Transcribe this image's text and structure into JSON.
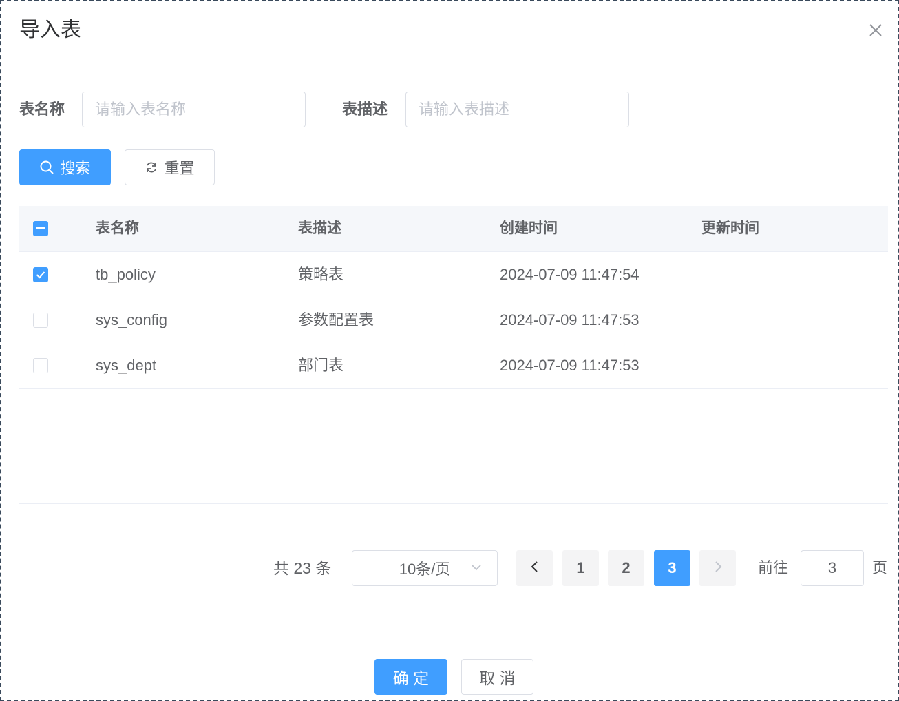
{
  "dialog": {
    "title": "导入表",
    "close_icon": "close-icon"
  },
  "search_form": {
    "table_name_label": "表名称",
    "table_name_placeholder": "请输入表名称",
    "table_name_value": "",
    "table_desc_label": "表描述",
    "table_desc_placeholder": "请输入表描述",
    "table_desc_value": "",
    "search_label": "搜索",
    "search_icon": "search-icon",
    "reset_label": "重置",
    "reset_icon": "refresh-icon"
  },
  "table": {
    "select_all_state": "indeterminate",
    "columns": [
      "表名称",
      "表描述",
      "创建时间",
      "更新时间"
    ],
    "rows": [
      {
        "checked": true,
        "name": "tb_policy",
        "desc": "策略表",
        "created": "2024-07-09 11:47:54",
        "updated": ""
      },
      {
        "checked": false,
        "name": "sys_config",
        "desc": "参数配置表",
        "created": "2024-07-09 11:47:53",
        "updated": ""
      },
      {
        "checked": false,
        "name": "sys_dept",
        "desc": "部门表",
        "created": "2024-07-09 11:47:53",
        "updated": ""
      }
    ]
  },
  "pagination": {
    "total_text": "共 23 条",
    "page_size": "10条/页",
    "pages": [
      "1",
      "2",
      "3"
    ],
    "current_page": "3",
    "goto_label": "前往",
    "goto_value": "3",
    "page_unit": "页"
  },
  "footer": {
    "confirm_label": "确 定",
    "cancel_label": "取 消"
  },
  "colors": {
    "primary": "#409eff",
    "border_dashed": "#3a4a5c",
    "header_bg": "#f5f7fa"
  }
}
